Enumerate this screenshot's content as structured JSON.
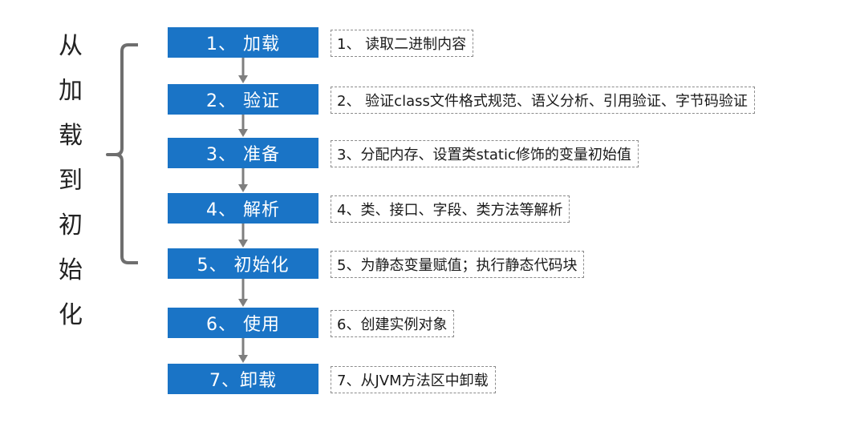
{
  "side_label": [
    "从",
    "加",
    "载",
    "到",
    "初",
    "始",
    "化"
  ],
  "steps": [
    {
      "label": "1、 加载",
      "desc": "1、 读取二进制内容"
    },
    {
      "label": "2、 验证",
      "desc": "2、 验证class文件格式规范、语义分析、引用验证、字节码验证"
    },
    {
      "label": "3、 准备",
      "desc": "3、分配内存、设置类static修饰的变量初始值"
    },
    {
      "label": "4、 解析",
      "desc": "4、类、接口、字段、类方法等解析"
    },
    {
      "label": "5、 初始化",
      "desc": "5、为静态变量赋值；执行静态代码块"
    },
    {
      "label": "6、 使用",
      "desc": "6、创建实例对象"
    },
    {
      "label": "7、卸载",
      "desc": "7、从JVM方法区中卸载"
    }
  ],
  "colors": {
    "step_fill": "#1a74c6",
    "arrow": "#7f7f7f",
    "bracket": "#6e6e6e"
  }
}
